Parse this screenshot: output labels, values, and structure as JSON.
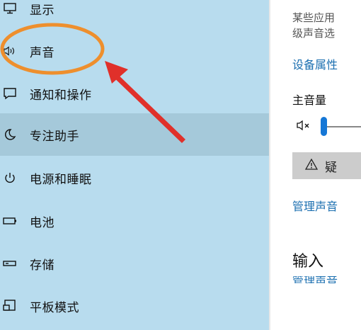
{
  "sidebar": {
    "items": [
      {
        "label": "显示",
        "icon": "monitor-icon"
      },
      {
        "label": "声音",
        "icon": "speaker-icon"
      },
      {
        "label": "通知和操作",
        "icon": "notification-icon"
      },
      {
        "label": "专注助手",
        "icon": "moon-icon"
      },
      {
        "label": "电源和睡眠",
        "icon": "power-icon"
      },
      {
        "label": "电池",
        "icon": "battery-icon"
      },
      {
        "label": "存储",
        "icon": "storage-icon"
      },
      {
        "label": "平板模式",
        "icon": "tablet-mode-icon"
      }
    ],
    "selected_index": 3
  },
  "content": {
    "description_line1": "某些应用",
    "description_line2": "级声音选",
    "device_properties_link": "设备属性",
    "master_volume_label": "主音量",
    "troubleshoot_label": "疑",
    "manage_sound_link": "管理声音",
    "input_heading": "输入",
    "partial_link": "管理声音"
  },
  "colors": {
    "sidebar_bg": "#b8dcee",
    "selected_bg": "#a5c9da",
    "link": "#1b6fb0",
    "accent": "#1577d6",
    "annotation": "#ee8f2d",
    "arrow": "#e0302a"
  }
}
